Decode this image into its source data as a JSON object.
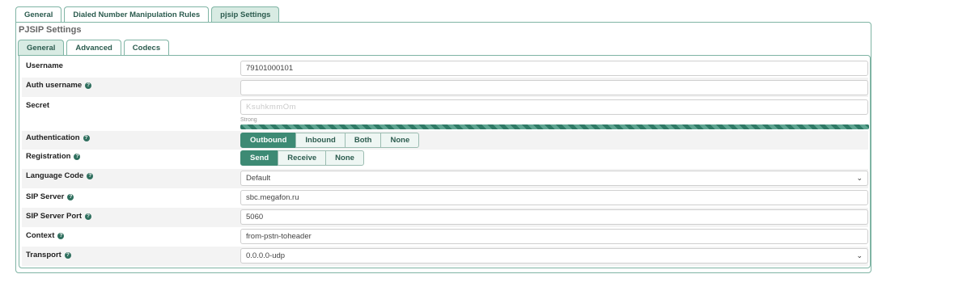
{
  "top_tabs": [
    "General",
    "Dialed Number Manipulation Rules",
    "pjsip Settings"
  ],
  "panel_title": "PJSIP Settings",
  "inner_tabs": [
    "General",
    "Advanced",
    "Codecs"
  ],
  "fields": {
    "username": {
      "label": "Username",
      "value": "79101000101"
    },
    "auth_username": {
      "label": "Auth username",
      "value": ""
    },
    "secret": {
      "label": "Secret",
      "value": "KsuhkmmOm",
      "strength_label": "Strong"
    },
    "authentication": {
      "label": "Authentication",
      "options": [
        "Outbound",
        "Inbound",
        "Both",
        "None"
      ],
      "selected": "Outbound"
    },
    "registration": {
      "label": "Registration",
      "options": [
        "Send",
        "Receive",
        "None"
      ],
      "selected": "Send"
    },
    "language_code": {
      "label": "Language Code",
      "value": "Default"
    },
    "sip_server": {
      "label": "SIP Server",
      "value": "sbc.megafon.ru"
    },
    "sip_server_port": {
      "label": "SIP Server Port",
      "value": "5060"
    },
    "context": {
      "label": "Context",
      "value": "from-pstn-toheader"
    },
    "transport": {
      "label": "Transport",
      "value": "0.0.0.0-udp"
    }
  },
  "colors": {
    "accent": "#3d8a74",
    "tab_border": "#7fb4a4",
    "row_alt": "#f3f3f3"
  },
  "icons": {
    "help": "question-circle-icon",
    "dropdown": "chevron-down-icon"
  }
}
